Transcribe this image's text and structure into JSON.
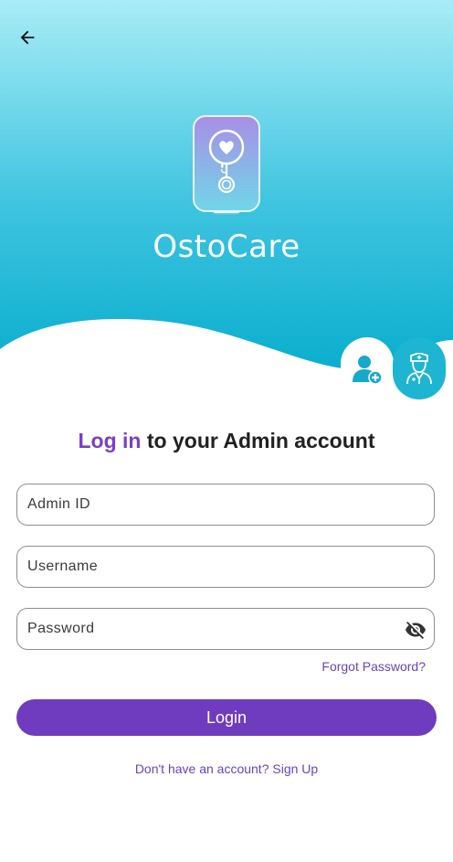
{
  "app": {
    "name": "OstoCare"
  },
  "colors": {
    "accent": "#6f3cc0",
    "gradient_top": "#a6ecf6",
    "gradient_bottom": "#10b1cf",
    "admin_role": "#1db5d2"
  },
  "icons": {
    "back": "arrow-left-icon",
    "user_role": "user-plus-icon",
    "admin_role": "nurse-icon",
    "password_toggle": "eye-off-icon"
  },
  "heading": {
    "accent": "Log in",
    "rest": " to your Admin account"
  },
  "form": {
    "admin_id_placeholder": "Admin ID",
    "username_placeholder": "Username",
    "password_placeholder": "Password",
    "forgot_label": "Forgot Password?",
    "login_label": "Login",
    "signup_label": "Don't have an account? Sign Up"
  }
}
